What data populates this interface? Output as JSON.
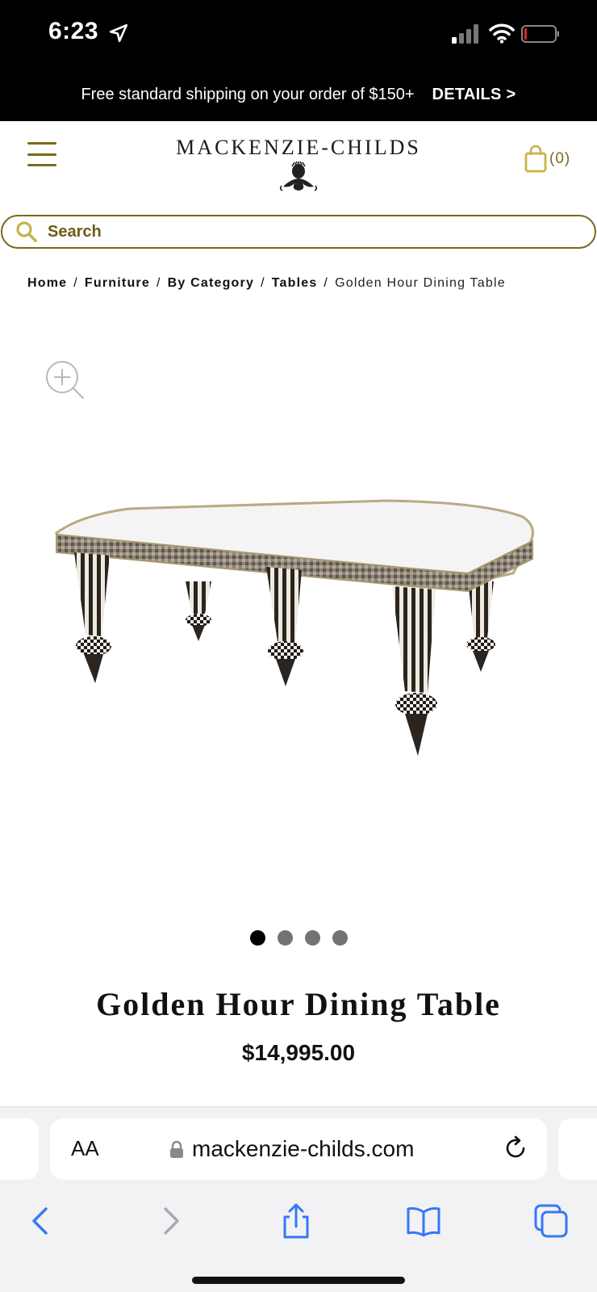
{
  "status_bar": {
    "time": "6:23",
    "icons": [
      "location-arrow-icon",
      "signal-icon",
      "wifi-icon",
      "battery-icon"
    ]
  },
  "promo": {
    "text": "Free standard shipping on your order of $150+",
    "details_label": "DETAILS >"
  },
  "header": {
    "logo_text": "MACKENZIE-CHILDS",
    "logo_icon": "thistle-icon",
    "cart_count": "(0)",
    "menu_icon": "hamburger-icon"
  },
  "search": {
    "placeholder": "Search"
  },
  "breadcrumb": {
    "items": [
      "Home",
      "Furniture",
      "By Category",
      "Tables"
    ],
    "current": "Golden Hour Dining Table",
    "separator": "/"
  },
  "product": {
    "title": "Golden Hour Dining Table",
    "price": "$14,995.00",
    "image_count": 4,
    "active_image": 1
  },
  "browser": {
    "text_size_label": "AA",
    "url": "mackenzie-childs.com",
    "toolbar_icons": [
      "back-icon",
      "forward-icon",
      "share-icon",
      "bookmarks-icon",
      "tabs-icon"
    ]
  },
  "colors": {
    "accent_gold": "#7a6a1c",
    "ios_blue": "#3478f6",
    "black": "#000000"
  }
}
